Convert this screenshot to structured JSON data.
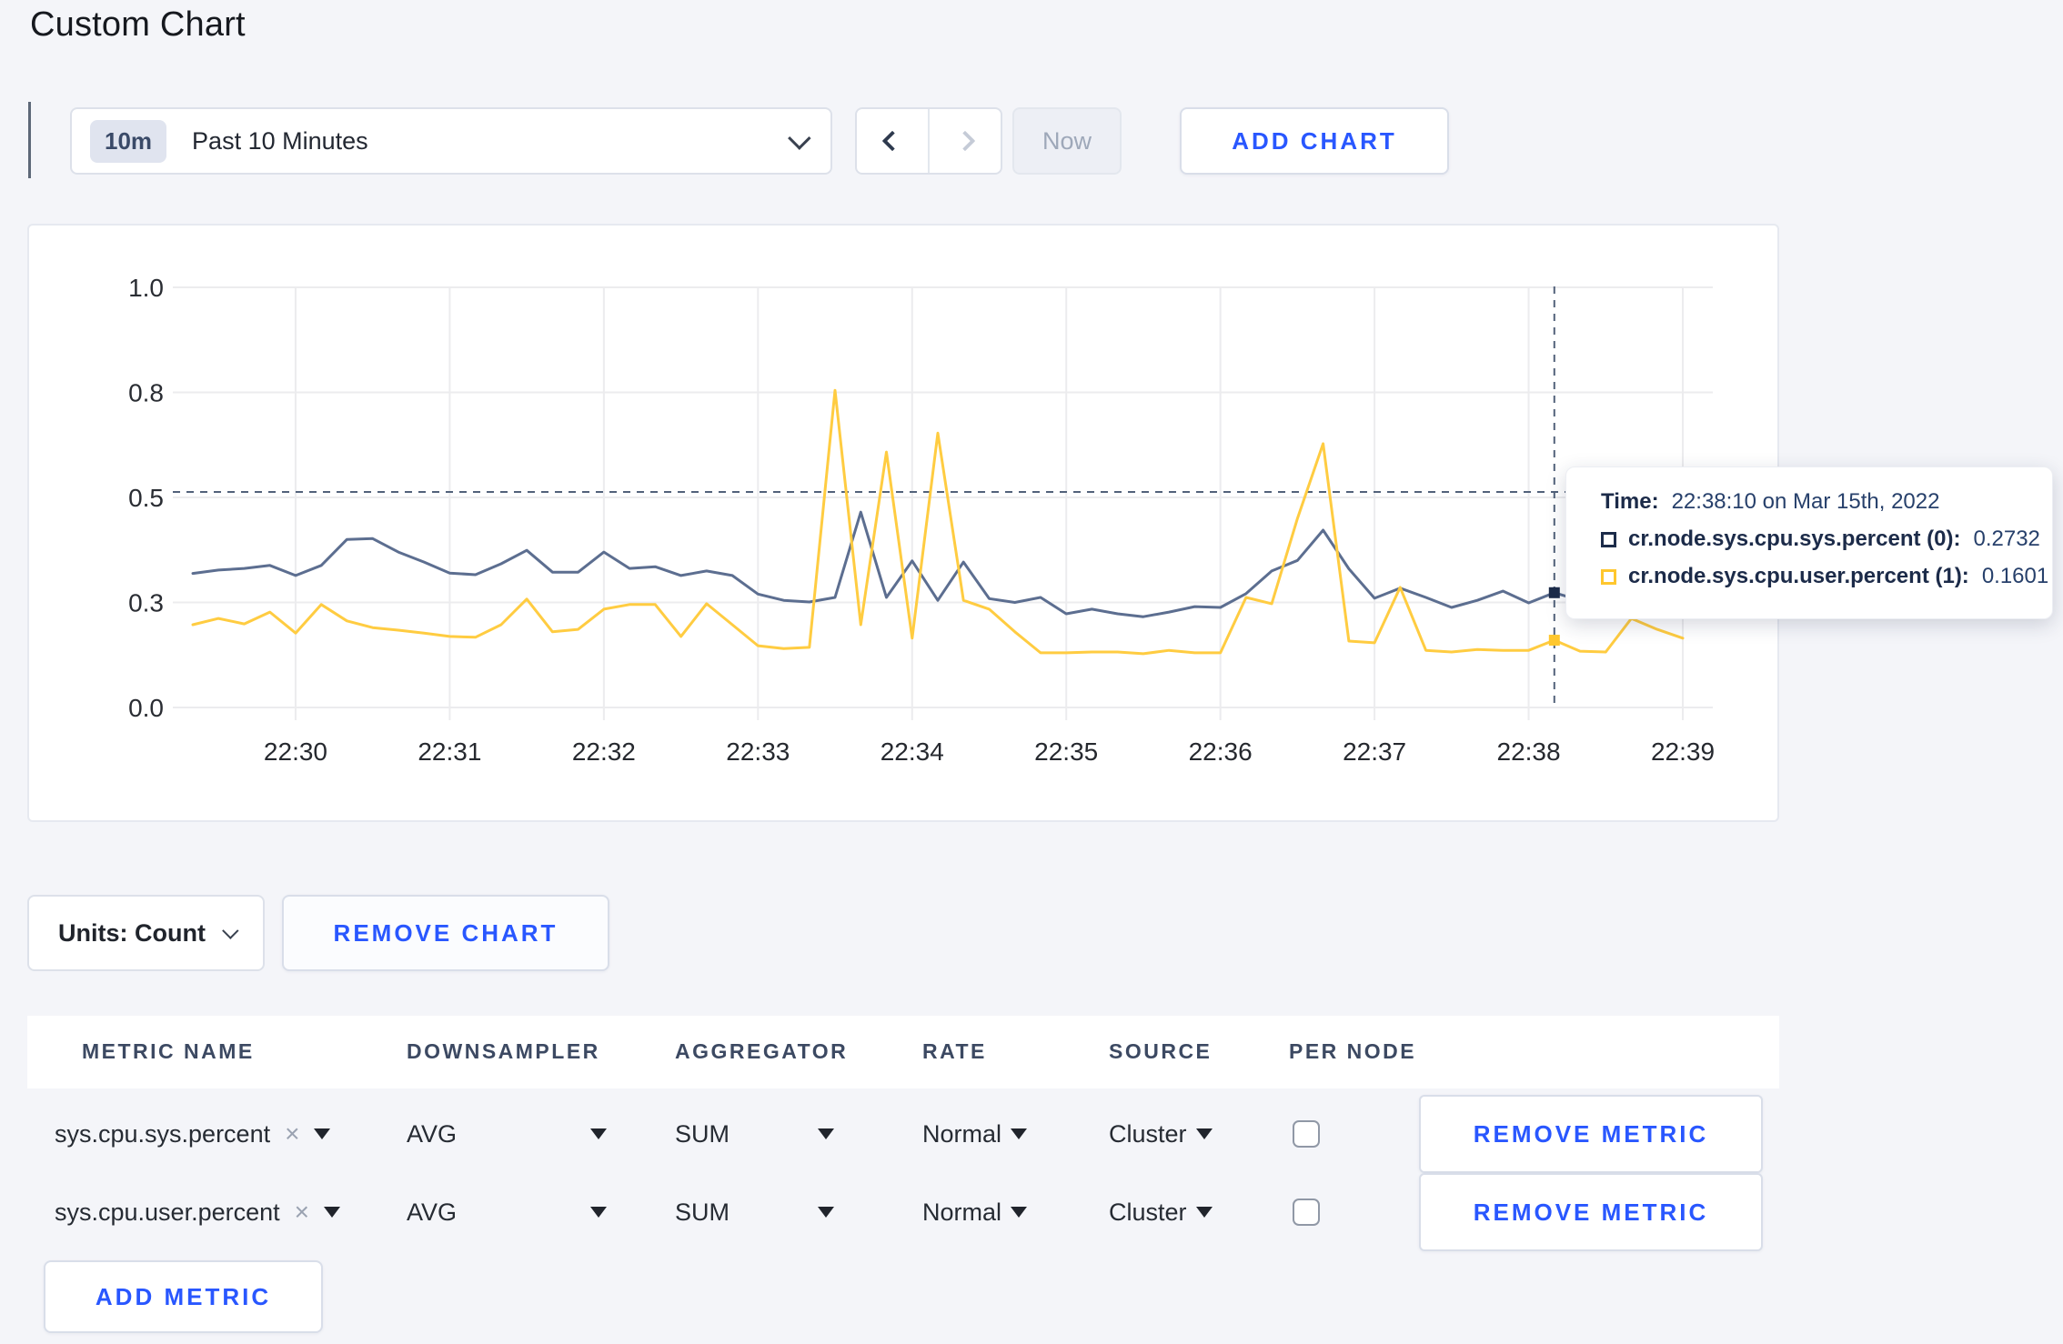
{
  "page": {
    "title": "Custom Chart"
  },
  "toolbar": {
    "time_range": {
      "badge": "10m",
      "label": "Past 10 Minutes"
    },
    "now_label": "Now",
    "add_chart_label": "ADD CHART"
  },
  "chart_data": {
    "type": "line",
    "title": "",
    "xlabel": "",
    "ylabel": "",
    "ylim": [
      0,
      1
    ],
    "grid": true,
    "legend_position": "tooltip-overlay",
    "x_start": "22:29:20",
    "x_end": "22:39:00",
    "x_interval_seconds": 10,
    "x_ticks": [
      "22:30",
      "22:31",
      "22:32",
      "22:33",
      "22:34",
      "22:35",
      "22:36",
      "22:37",
      "22:38",
      "22:39"
    ],
    "y_ticks": {
      "labels": [
        "0.0",
        "0.3",
        "0.5",
        "0.8",
        "1.0"
      ],
      "values": [
        0,
        0.25,
        0.5,
        0.75,
        1.0
      ]
    },
    "series": [
      {
        "name": "cr.node.sys.cpu.sys.percent",
        "node": "(0)",
        "color": "#5c6e90",
        "values": [
          0.319,
          0.327,
          0.331,
          0.338,
          0.314,
          0.338,
          0.4,
          0.402,
          0.37,
          0.346,
          0.32,
          0.316,
          0.342,
          0.374,
          0.322,
          0.322,
          0.37,
          0.331,
          0.335,
          0.314,
          0.325,
          0.314,
          0.27,
          0.255,
          0.251,
          0.262,
          0.465,
          0.262,
          0.349,
          0.255,
          0.346,
          0.259,
          0.25,
          0.262,
          0.223,
          0.234,
          0.223,
          0.216,
          0.227,
          0.24,
          0.238,
          0.271,
          0.325,
          0.35,
          0.422,
          0.33,
          0.26,
          0.284,
          0.262,
          0.238,
          0.255,
          0.277,
          0.249,
          0.2732,
          0.255,
          0.27,
          0.29,
          0.28,
          0.3
        ]
      },
      {
        "name": "cr.node.sys.cpu.user.percent",
        "node": "(1)",
        "color": "#ffcc41",
        "values": [
          0.197,
          0.212,
          0.199,
          0.227,
          0.177,
          0.245,
          0.206,
          0.19,
          0.184,
          0.177,
          0.169,
          0.167,
          0.197,
          0.258,
          0.18,
          0.186,
          0.234,
          0.245,
          0.245,
          0.169,
          0.247,
          0.197,
          0.147,
          0.14,
          0.143,
          0.755,
          0.197,
          0.608,
          0.165,
          0.653,
          0.255,
          0.234,
          0.18,
          0.13,
          0.13,
          0.132,
          0.132,
          0.128,
          0.136,
          0.13,
          0.13,
          0.262,
          0.247,
          0.45,
          0.628,
          0.158,
          0.154,
          0.286,
          0.136,
          0.132,
          0.138,
          0.136,
          0.136,
          0.1601,
          0.134,
          0.132,
          0.212,
          0.186,
          0.165
        ]
      }
    ],
    "crosshair": {
      "index": 53,
      "time": "22:38:10",
      "hline_value": 0.513
    }
  },
  "tooltip": {
    "time_label": "Time:",
    "time_value": "22:38:10 on Mar 15th, 2022",
    "row1_label": "cr.node.sys.cpu.sys.percent (0):",
    "row1_value": "0.2732",
    "row2_label": "cr.node.sys.cpu.user.percent (1):",
    "row2_value": "0.1601"
  },
  "chart_footer": {
    "units_label": "Units: Count",
    "remove_chart_label": "REMOVE CHART"
  },
  "metrics_table": {
    "headers": [
      "METRIC NAME",
      "DOWNSAMPLER",
      "AGGREGATOR",
      "RATE",
      "SOURCE",
      "PER NODE"
    ],
    "rows": [
      {
        "metric": "sys.cpu.sys.percent",
        "downsampler": "AVG",
        "aggregator": "SUM",
        "rate": "Normal",
        "source": "Cluster",
        "per_node_checked": false,
        "remove_label": "REMOVE METRIC"
      },
      {
        "metric": "sys.cpu.user.percent",
        "downsampler": "AVG",
        "aggregator": "SUM",
        "rate": "Normal",
        "source": "Cluster",
        "per_node_checked": false,
        "remove_label": "REMOVE METRIC"
      }
    ],
    "add_metric_label": "ADD METRIC"
  },
  "colors": {
    "accent_blue": "#2957ff",
    "series_sys": "#5c6e90",
    "series_user": "#ffcc41",
    "swatch_sys": "#1c2b49",
    "swatch_user": "#ffc72e",
    "gridline": "#ececee",
    "crosshair": "#52627a",
    "page_bg": "#f4f5f9"
  }
}
